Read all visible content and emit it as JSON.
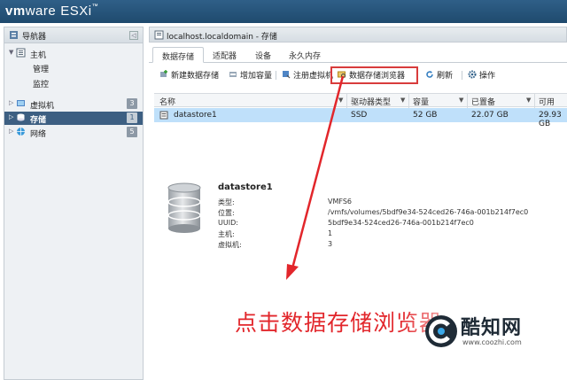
{
  "app": {
    "brand_vm": "vm",
    "brand_ware": "ware",
    "brand_product": "ESXi",
    "brand_tm": "™"
  },
  "sidebar": {
    "title": "导航器",
    "items": [
      {
        "label": "主机",
        "subitems": [
          "管理",
          "监控"
        ]
      },
      {
        "label": "虚拟机",
        "badge": "3"
      },
      {
        "label": "存储",
        "badge": "1",
        "selected": true
      },
      {
        "label": "网络",
        "badge": "5"
      }
    ]
  },
  "panel": {
    "title": "localhost.localdomain - 存储"
  },
  "tabs": [
    "数据存储",
    "适配器",
    "设备",
    "永久内存"
  ],
  "toolbar": {
    "new_datastore": "新建数据存储",
    "increase_capacity": "增加容量",
    "register_vm": "注册虚拟机",
    "datastore_browser": "数据存储浏览器",
    "refresh": "刷新",
    "actions": "操作"
  },
  "table": {
    "columns": [
      "名称",
      "驱动器类型",
      "容量",
      "已置备",
      "可用"
    ],
    "rows": [
      {
        "name": "datastore1",
        "drive_type": "SSD",
        "capacity": "52 GB",
        "provisioned": "22.07 GB",
        "free": "29.93 GB"
      }
    ]
  },
  "detail": {
    "title": "datastore1",
    "fields": [
      {
        "label": "类型:",
        "value": "VMFS6"
      },
      {
        "label": "位置:",
        "value": "/vmfs/volumes/5bdf9e34-524ced26-746a-001b214f7ec0"
      },
      {
        "label": "UUID:",
        "value": "5bdf9e34-524ced26-746a-001b214f7ec0"
      },
      {
        "label": "主机:",
        "value": "1"
      },
      {
        "label": "虚拟机:",
        "value": "3"
      }
    ]
  },
  "annotation": {
    "text": "点击数据存储浏览器",
    "color": "#e2262b"
  },
  "watermark": {
    "name": "酷知网",
    "url": "www.coozhi.com"
  },
  "colors": {
    "topbar": "#2f5f88",
    "selected_nav": "#3d5f82",
    "selected_row": "#bfe0fa",
    "highlight_box": "#d83c3c"
  }
}
